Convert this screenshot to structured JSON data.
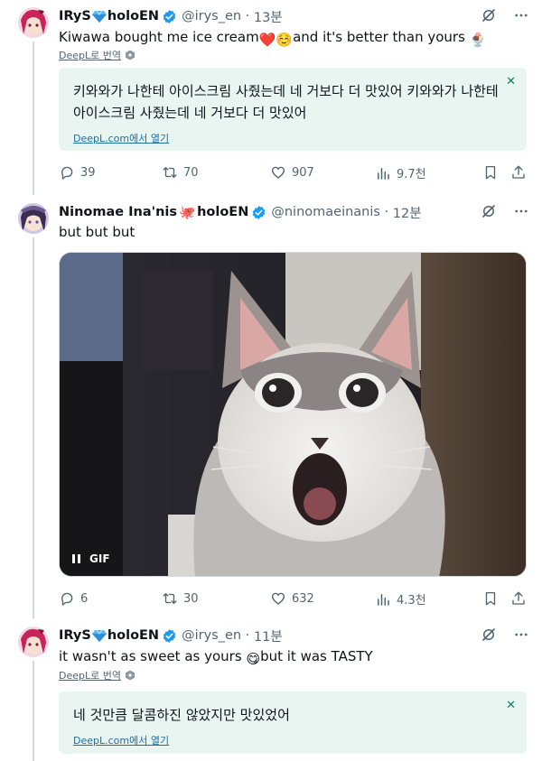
{
  "tweets": [
    {
      "name": "IRyS",
      "org": "holoEN",
      "handle": "@irys_en",
      "time": "13분",
      "text_part1": "Kiwawa bought me ice cream",
      "text_emoji1": "❤️",
      "text_emoji2": "☺️",
      "text_part2": "and it's better than yours",
      "text_emoji3": "🍨",
      "translate_label": "DeepL로 번역",
      "deepl_text": "키와와가 나한테 아이스크림 사줬는데 네 거보다 더 맛있어 키와와가 나한테 아이스크림 사줬는데 네 거보다 더 맛있어",
      "deepl_open": "DeepL.com에서 열기",
      "deepl_close": "✕",
      "replies": "39",
      "retweets": "70",
      "likes": "907",
      "views": "9.7천"
    },
    {
      "name": "Ninomae Ina'nis",
      "org": "holoEN",
      "octo": "🐙",
      "handle": "@ninomaeinanis",
      "time": "12분",
      "text": "but but but",
      "gif_label": "GIF",
      "replies": "6",
      "retweets": "30",
      "likes": "632",
      "views": "4.3천"
    },
    {
      "name": "IRyS",
      "org": "holoEN",
      "handle": "@irys_en",
      "time": "11분",
      "text_part1": "it wasn't as sweet as yours",
      "text_emoji1": "😋",
      "text_part2": "but it was TASTY",
      "translate_label": "DeepL로 번역",
      "deepl_text": "네 것만큼 달콤하진 않았지만 맛있었어",
      "deepl_open": "DeepL.com에서 열기",
      "deepl_close": "✕"
    }
  ],
  "separator": " · ",
  "colors": {
    "verified": "#1d9bf0",
    "deepl_bg": "#e8f5f1",
    "muted": "#536471"
  }
}
